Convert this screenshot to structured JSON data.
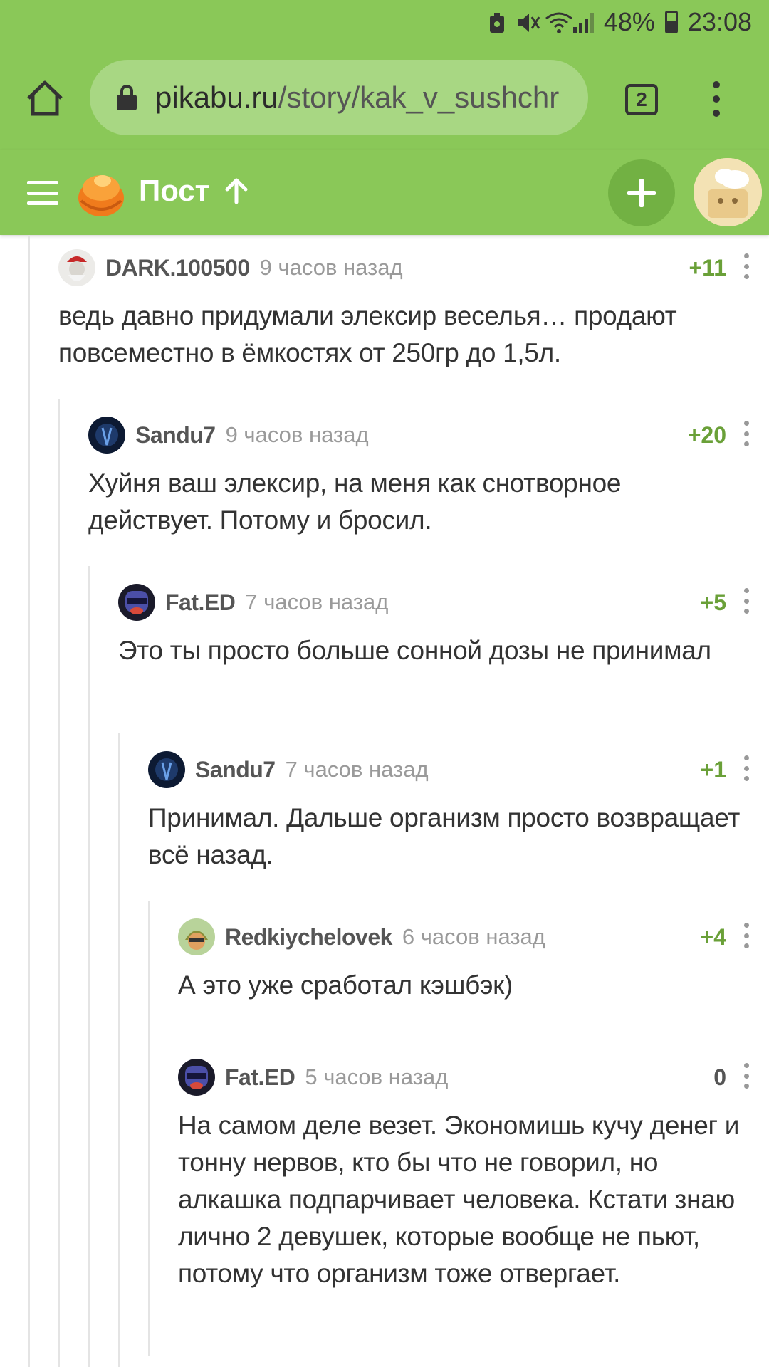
{
  "status_bar": {
    "battery": "48%",
    "time": "23:08",
    "icons": [
      "shield-icon",
      "mute-icon",
      "wifi-icon",
      "signal-icon",
      "battery-icon"
    ]
  },
  "browser": {
    "url_domain": "pikabu.ru",
    "url_path": "/story/kak_v_sushchr",
    "tab_count": "2"
  },
  "app_header": {
    "title": "Пост"
  },
  "colors": {
    "brand_green": "#8ac858",
    "rating_green": "#6aa038"
  },
  "comments": [
    {
      "user": "DARK.100500",
      "time": "9 часов назад",
      "rating": "+11",
      "text": "ведь давно придумали элексир веселья… продают повсеместно в ёмкостях от 250гр до 1,5л."
    },
    {
      "user": "Sandu7",
      "time": "9 часов назад",
      "rating": "+20",
      "text": "Хуйня ваш элексир, на меня как снотворное действует. Потому и бросил."
    },
    {
      "user": "Fat.ED",
      "time": "7 часов назад",
      "rating": "+5",
      "text": "Это ты просто больше сонной дозы не принимал"
    },
    {
      "user": "Sandu7",
      "time": "7 часов назад",
      "rating": "+1",
      "text": "Принимал. Дальше организм просто возвращает всё назад."
    },
    {
      "user": "Redkiychelovek",
      "time": "6 часов назад",
      "rating": "+4",
      "text": "А это уже сработал кэшбэк)"
    },
    {
      "user": "Fat.ED",
      "time": "5 часов назад",
      "rating": "0",
      "text": "На самом деле везет. Экономишь кучу денег и тонну нервов, кто бы что не говорил, но алкашка подпарчивает человека. Кстати знаю лично 2 девушек, которые вообще не пьют, потому что организм тоже отвергает."
    }
  ]
}
